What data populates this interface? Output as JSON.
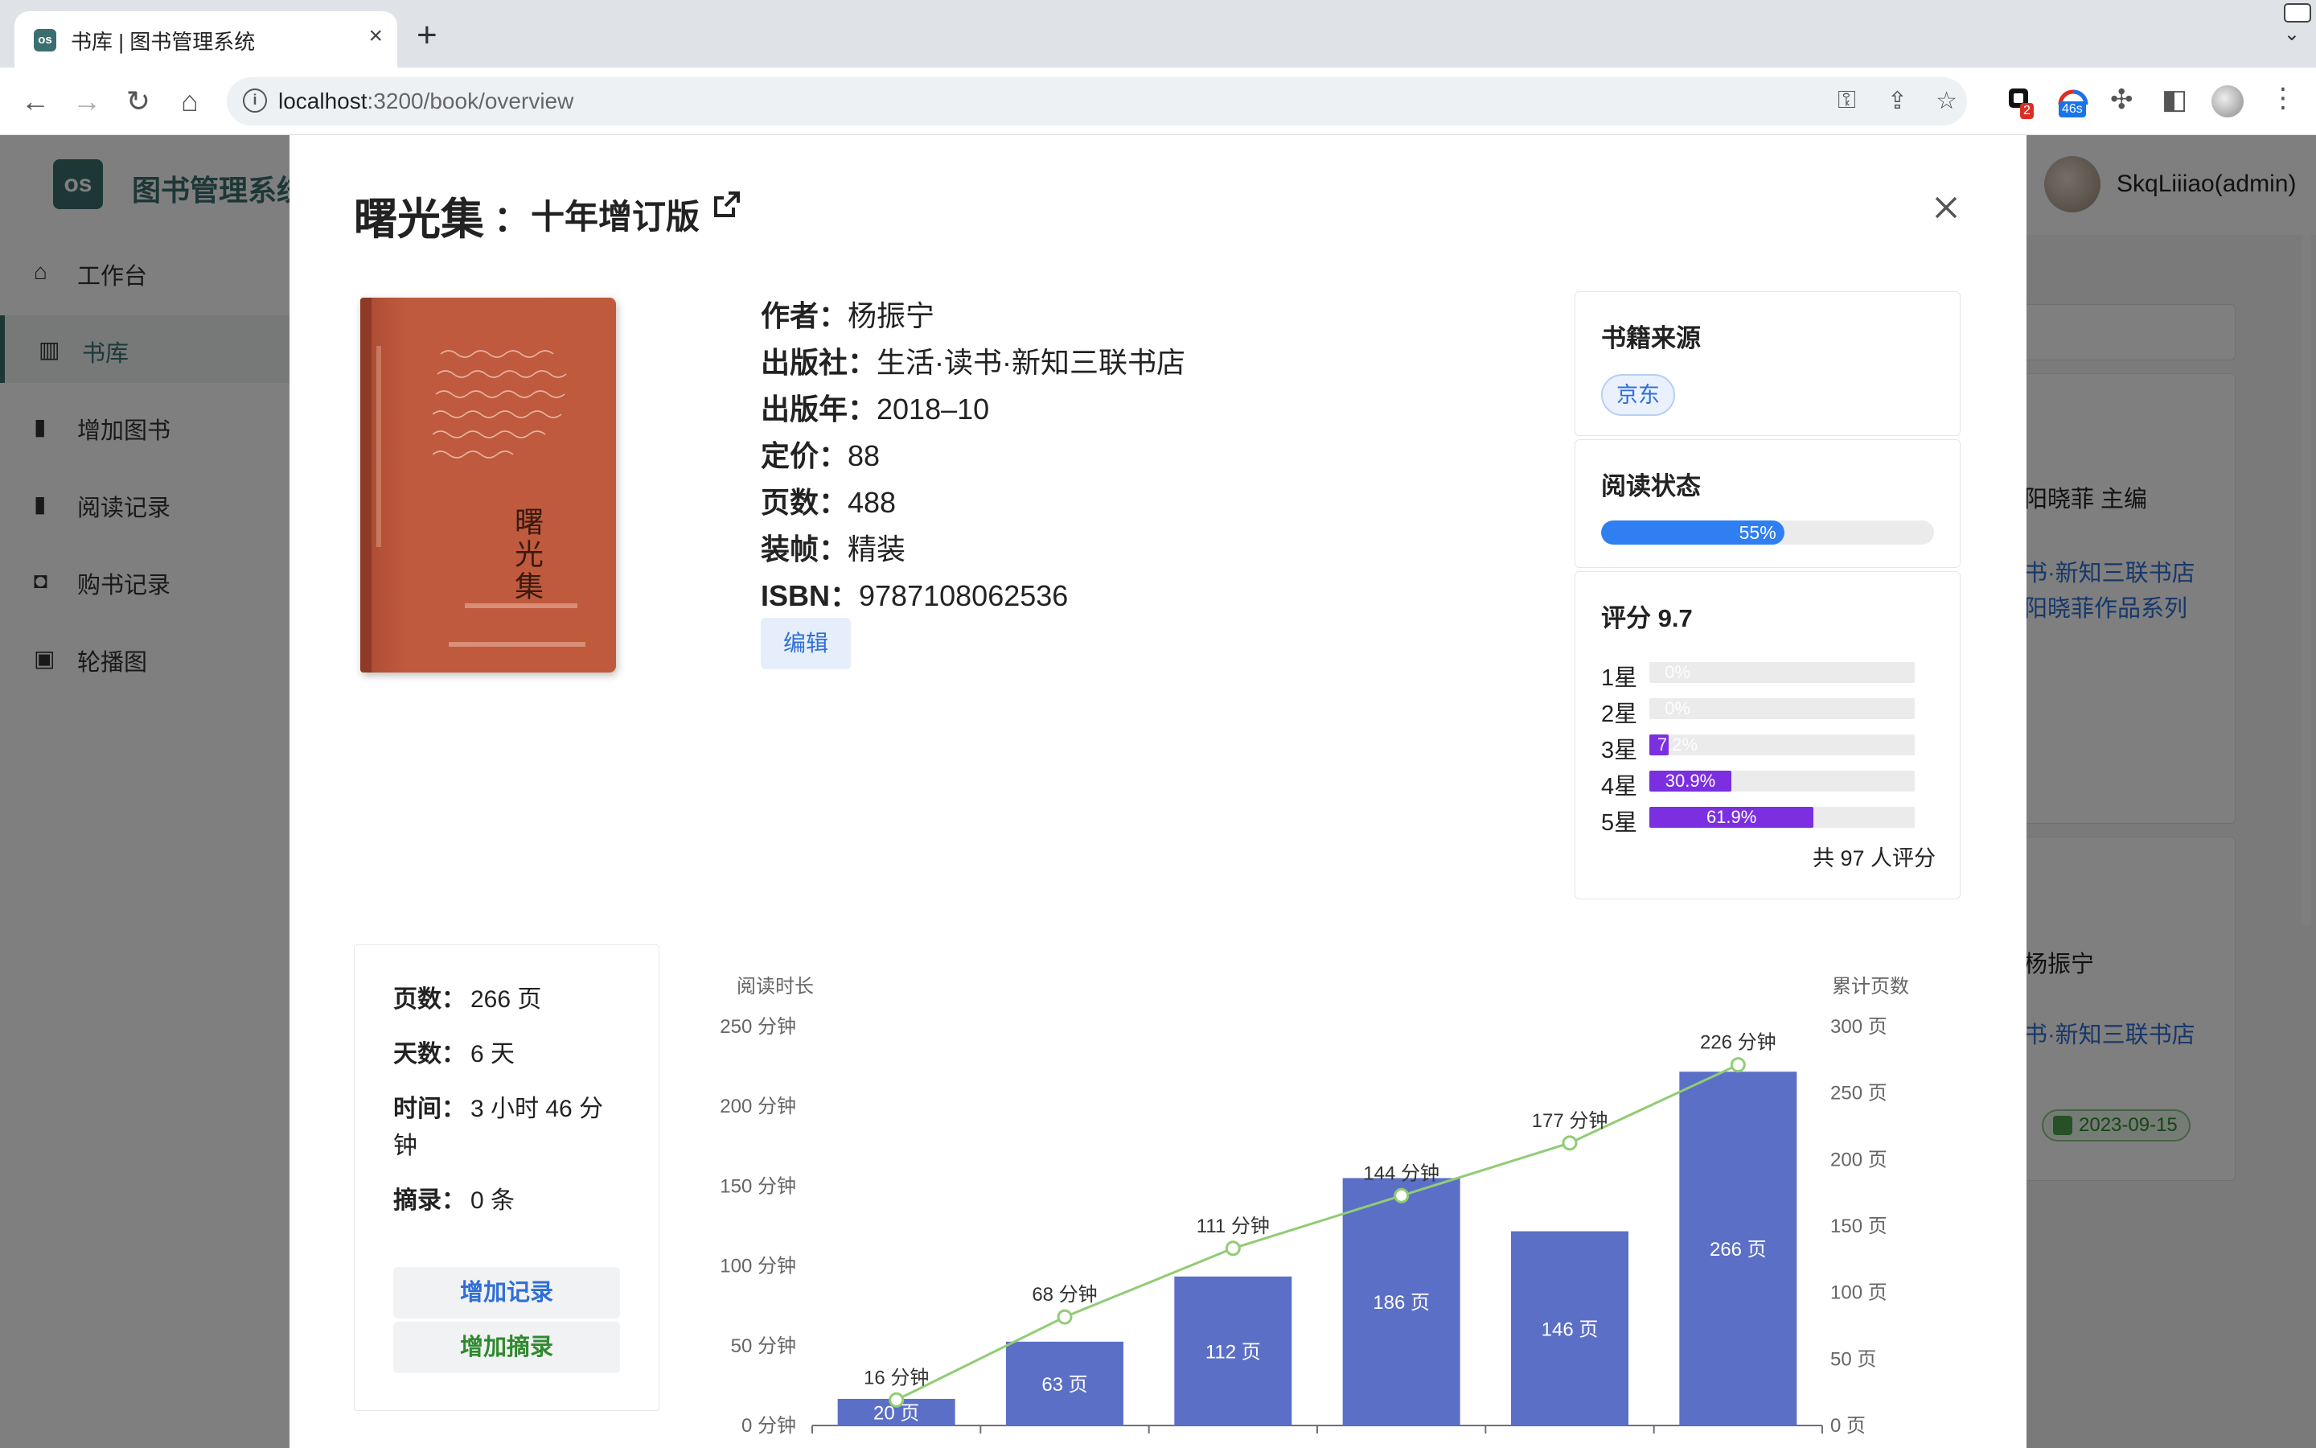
{
  "browser": {
    "tab_title": "书库 | 图书管理系统",
    "url_host": "localhost",
    "url_rest": ":3200/book/overview",
    "ext_badges": [
      "2",
      "46s"
    ]
  },
  "app": {
    "title": "图书管理系统",
    "user": "SkqLiiiao(admin)",
    "sidebar": [
      {
        "label": "工作台",
        "icon": "home-icon"
      },
      {
        "label": "书库",
        "icon": "library-icon"
      },
      {
        "label": "增加图书",
        "icon": "add-book-icon"
      },
      {
        "label": "阅读记录",
        "icon": "reading-record-icon"
      },
      {
        "label": "购书记录",
        "icon": "shopping-bag-icon"
      },
      {
        "label": "轮播图",
        "icon": "carousel-icon"
      }
    ],
    "background": {
      "text1": "阳晓菲 主编",
      "link1": "书·新知三联书店",
      "link2": "阳晓菲作品系列",
      "text2": "杨振宁",
      "link3": "书·新知三联书店",
      "date_tag": "2023-09-15"
    }
  },
  "modal": {
    "title": "曙光集",
    "separator": "：",
    "subtitle": "十年增订版",
    "book": {
      "author_k": "作者：",
      "author_v": "杨振宁",
      "publisher_k": "出版社：",
      "publisher_v": "生活·读书·新知三联书店",
      "year_k": "出版年：",
      "year_v": "2018–10",
      "price_k": "定价：",
      "price_v": "88",
      "pages_k": "页数：",
      "pages_v": "488",
      "binding_k": "装帧：",
      "binding_v": "精装",
      "isbn_k": "ISBN：",
      "isbn_v": "9787108062536",
      "cover_title": "曙光集"
    },
    "edit_label": "编辑",
    "source": {
      "title": "书籍来源",
      "tag": "京东"
    },
    "reading_status": {
      "title": "阅读状态",
      "progress": 0.55,
      "progress_label": "55%"
    },
    "rating": {
      "title": "评分 9.7",
      "rows": [
        {
          "label": "1星",
          "pct": 0,
          "pct_label": "0%"
        },
        {
          "label": "2星",
          "pct": 0,
          "pct_label": "0%"
        },
        {
          "label": "3星",
          "pct": 7.2,
          "pct_label": "7.2%"
        },
        {
          "label": "4星",
          "pct": 30.9,
          "pct_label": "30.9%"
        },
        {
          "label": "5星",
          "pct": 61.9,
          "pct_label": "61.9%"
        }
      ],
      "total": "共 97 人评分"
    },
    "stats": {
      "pages_k": "页数：",
      "pages_v": "266 页",
      "days_k": "天数：",
      "days_v": "6 天",
      "time_k": "时间：",
      "time_v": "3 小时 46 分",
      "time_v2": "钟",
      "excerpt_k": "摘录：",
      "excerpt_v": "0 条",
      "add_record": "增加记录",
      "add_excerpt": "增加摘录"
    }
  },
  "chart_data": {
    "type": "bar",
    "y_left_name": "阅读时长",
    "y_right_name": "累计页数",
    "y_left_ticks": [
      "0 分钟",
      "50 分钟",
      "100 分钟",
      "150 分钟",
      "200 分钟",
      "250 分钟"
    ],
    "y_right_ticks": [
      "0 页",
      "50 页",
      "100 页",
      "150 页",
      "200 页",
      "250 页",
      "300 页"
    ],
    "ylim_left": [
      0,
      250
    ],
    "ylim_right": [
      0,
      300
    ],
    "series": [
      {
        "name": "累计页数",
        "kind": "bar",
        "axis": "right",
        "values": [
          20,
          63,
          112,
          186,
          146,
          266
        ],
        "labels": [
          "20 页",
          "63 页",
          "112 页",
          "186 页",
          "146 页",
          "266 页"
        ],
        "color": "#5b6fc6"
      },
      {
        "name": "阅读时长",
        "kind": "line",
        "axis": "left",
        "values": [
          16,
          68,
          111,
          144,
          177,
          226
        ],
        "labels": [
          "16 分钟",
          "68 分钟",
          "111 分钟",
          "144 分钟",
          "177 分钟",
          "226 分钟"
        ],
        "color": "#91cc75"
      }
    ]
  }
}
